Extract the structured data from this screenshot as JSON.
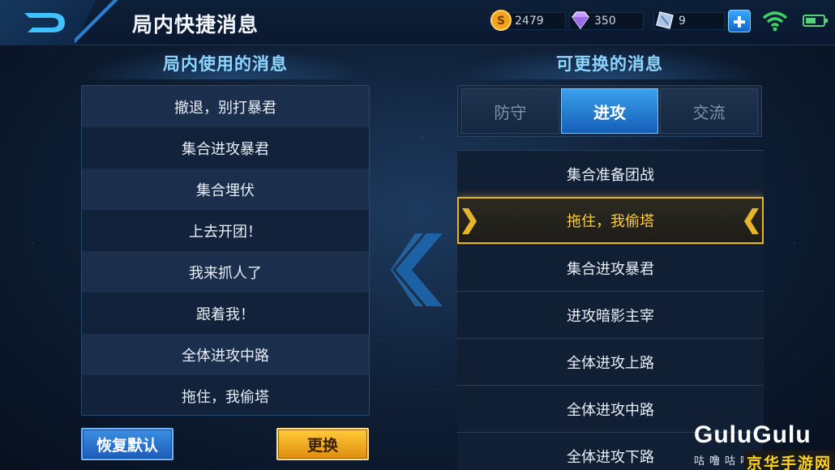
{
  "header": {
    "title": "局内快捷消息",
    "gold": "2479",
    "diamonds": "350",
    "vouchers": "9"
  },
  "left_panel": {
    "title": "局内使用的消息",
    "items": [
      "撤退，别打暴君",
      "集合进攻暴君",
      "集合埋伏",
      "上去开团！",
      "我来抓人了",
      "跟着我！",
      "全体进攻中路",
      "拖住，我偷塔"
    ],
    "restore_label": "恢复默认",
    "replace_label": "更换"
  },
  "right_panel": {
    "title": "可更换的消息",
    "tabs": [
      "防守",
      "进攻",
      "交流"
    ],
    "active_tab": 1,
    "items": [
      "集合准备团战",
      "拖住，我偷塔",
      "集合进攻暴君",
      "进攻暗影主宰",
      "全体进攻上路",
      "全体进攻中路",
      "全体进攻下路"
    ],
    "selected_index": 1
  },
  "watermark": {
    "main": "GuluGulu",
    "sub": "咕噜咕噜",
    "brand": "京华手游网"
  },
  "colors": {
    "accent_blue": "#3aa0ee",
    "highlight_gold": "#ffcf3a",
    "title_cyan": "#8fd6ff"
  }
}
